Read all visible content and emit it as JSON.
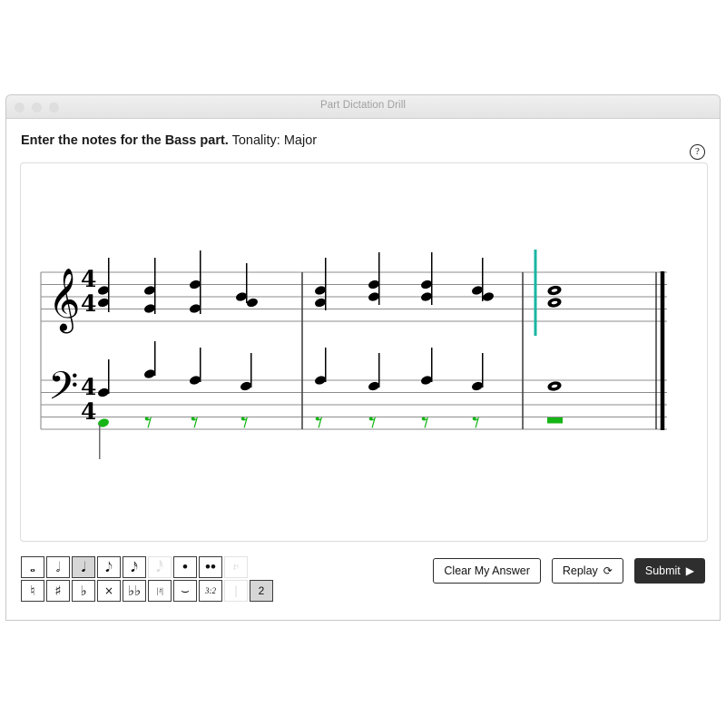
{
  "window": {
    "title": "Part Dictation Drill",
    "traffic_lights": [
      "close-dot",
      "minimize-dot",
      "zoom-dot"
    ]
  },
  "prompt": {
    "instruction": "Enter the notes for the Bass part.",
    "tonality_label": "Tonality: Major",
    "help_icon": "question-mark-circle-icon",
    "help_glyph": "?"
  },
  "score": {
    "time_signature": {
      "numerator": "4",
      "denominator": "4"
    },
    "clefs": {
      "upper": "treble-clef",
      "lower": "bass-clef"
    },
    "measures": 3,
    "cursor_color": "#1ab5a3",
    "entry_color": "#16b516",
    "staff_color": "#8c8c8c",
    "ink_color": "#000000",
    "upper_staff": {
      "voice_soprano_alto": "chords-quarter-notes",
      "measure1_beats": 4,
      "measure2_beats": 4,
      "measure3": "whole-note-chord"
    },
    "lower_staff": {
      "tenor_voice": "quarter-notes",
      "bass_voice_entered": "one-quarter-note-then-rests",
      "rests": "quarter-rest",
      "measure3_bass": "whole-rest-entered",
      "measure3_tenor": "whole-note"
    }
  },
  "palette": {
    "row1": [
      {
        "name": "whole-note-button",
        "glyph": "𝅝",
        "state": "normal"
      },
      {
        "name": "half-note-button",
        "glyph": "𝅗𝅥",
        "state": "normal"
      },
      {
        "name": "quarter-note-button",
        "glyph": "𝅘𝅥",
        "state": "selected"
      },
      {
        "name": "eighth-note-button",
        "glyph": "𝅘𝅥𝅮",
        "state": "normal"
      },
      {
        "name": "sixteenth-note-button",
        "glyph": "𝅘𝅥𝅯",
        "state": "normal"
      },
      {
        "name": "thirtysecond-note-button",
        "glyph": "𝅘𝅥𝅰",
        "state": "disabled"
      },
      {
        "name": "dot-button",
        "glyph": "•",
        "state": "normal"
      },
      {
        "name": "double-dot-button",
        "glyph": "••",
        "state": "normal"
      },
      {
        "name": "rest-button",
        "glyph": "𝄽𝄾",
        "state": "disabled"
      }
    ],
    "row2": [
      {
        "name": "natural-button",
        "glyph": "♮",
        "state": "normal"
      },
      {
        "name": "sharp-button",
        "glyph": "♯",
        "state": "normal"
      },
      {
        "name": "flat-button",
        "glyph": "♭",
        "state": "normal"
      },
      {
        "name": "double-sharp-button",
        "glyph": "×",
        "state": "normal"
      },
      {
        "name": "double-flat-button",
        "glyph": "♭♭",
        "state": "normal"
      },
      {
        "name": "courtesy-accidental-button",
        "glyph": "|♮|",
        "state": "normal"
      },
      {
        "name": "tie-button",
        "glyph": "⌣",
        "state": "normal"
      },
      {
        "name": "triplet-button",
        "glyph": "3:2",
        "state": "normal"
      },
      {
        "name": "barline-button",
        "glyph": "|",
        "state": "disabled"
      },
      {
        "name": "voice-2-button",
        "glyph": "2",
        "state": "selected"
      }
    ]
  },
  "actions": {
    "clear_label": "Clear My Answer",
    "replay_label": "Replay",
    "replay_icon": "refresh-icon",
    "replay_glyph": "⟳",
    "submit_label": "Submit",
    "submit_icon": "play-triangle-icon",
    "submit_glyph": "▶"
  }
}
